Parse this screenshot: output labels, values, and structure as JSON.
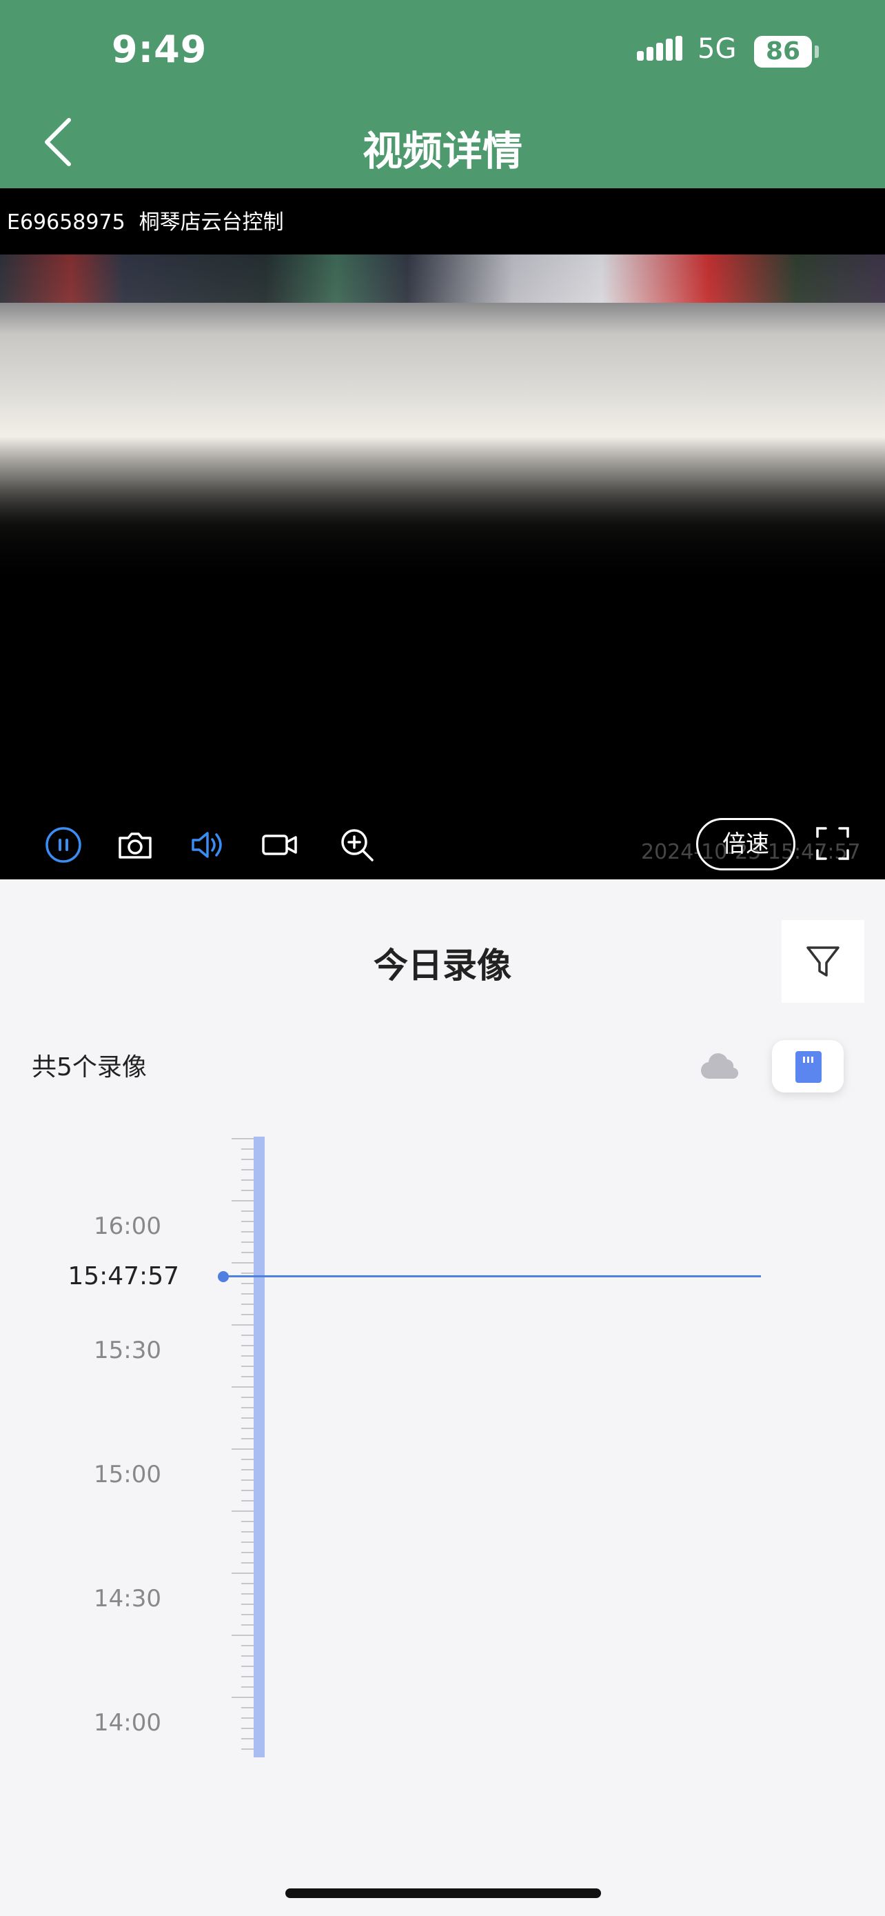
{
  "status_bar": {
    "time": "9:49",
    "network": "5G",
    "battery": "86"
  },
  "header": {
    "title": "视频详情"
  },
  "video": {
    "device_id": "E69658975",
    "device_name": "桐琴店云台控制",
    "speed_label": "倍速",
    "overlay_date": "2024-10-25 15:47:57"
  },
  "recordings": {
    "title": "今日录像",
    "count_text": "共5个录像"
  },
  "timeline": {
    "labels": [
      "16:00",
      "15:30",
      "15:00",
      "14:30",
      "14:00"
    ],
    "current_time": "15:47:57"
  },
  "colors": {
    "header_bg": "#4e9a6e",
    "accent": "#4f7fe0",
    "bar": "#a9bdf2"
  }
}
